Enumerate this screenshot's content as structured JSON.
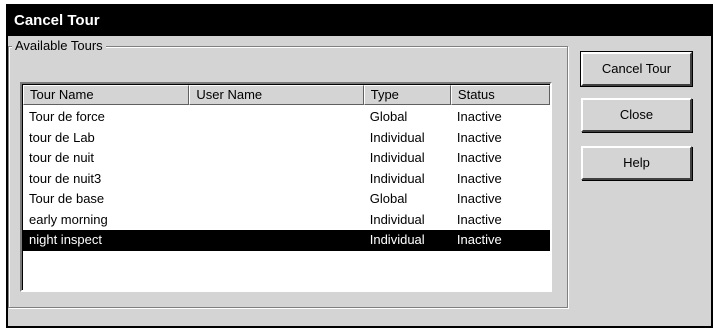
{
  "window": {
    "title": "Cancel Tour"
  },
  "group": {
    "label": "Available Tours"
  },
  "columns": {
    "tour_name": "Tour Name",
    "user_name": "User Name",
    "type": "Type",
    "status": "Status"
  },
  "rows": [
    {
      "tour_name": "Tour de force",
      "user_name": "",
      "type": "Global",
      "status": "Inactive",
      "selected": false
    },
    {
      "tour_name": "tour de Lab",
      "user_name": "",
      "type": "Individual",
      "status": "Inactive",
      "selected": false
    },
    {
      "tour_name": "tour de nuit",
      "user_name": "",
      "type": "Individual",
      "status": "Inactive",
      "selected": false
    },
    {
      "tour_name": "tour de nuit3",
      "user_name": "",
      "type": "Individual",
      "status": "Inactive",
      "selected": false
    },
    {
      "tour_name": "Tour de base",
      "user_name": "",
      "type": "Global",
      "status": "Inactive",
      "selected": false
    },
    {
      "tour_name": "early morning",
      "user_name": "",
      "type": "Individual",
      "status": "Inactive",
      "selected": false
    },
    {
      "tour_name": "night inspect",
      "user_name": "",
      "type": "Individual",
      "status": "Inactive",
      "selected": true
    }
  ],
  "buttons": {
    "cancel_tour": "Cancel Tour",
    "close": "Close",
    "help": "Help"
  },
  "colors": {
    "title_bar": "#000000",
    "dialog_face": "#d4d4d4",
    "selection": "#000000"
  }
}
